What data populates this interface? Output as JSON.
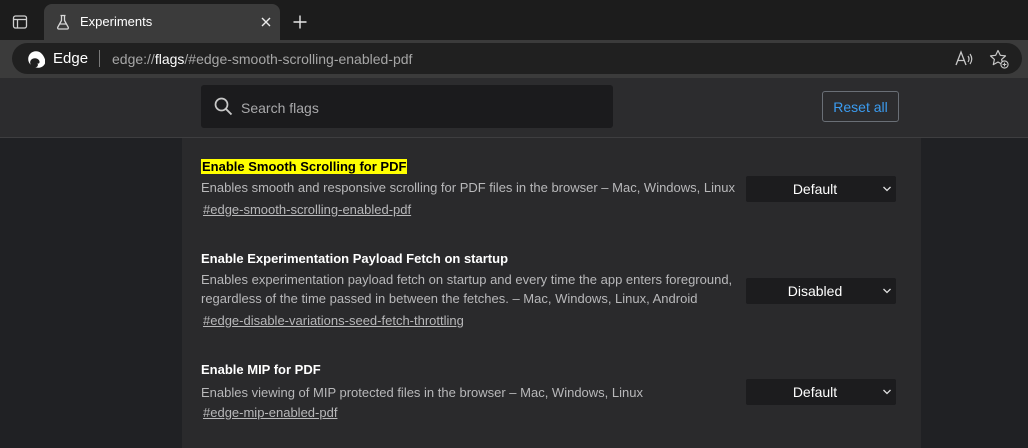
{
  "browser": {
    "tab": {
      "title": "Experiments"
    },
    "omnibox": {
      "brand": "Edge",
      "url_scheme": "edge://",
      "url_host": "flags",
      "url_rest": "/#edge-smooth-scrolling-enabled-pdf"
    },
    "icons": [
      "tab-actions-icon",
      "flask-icon",
      "close-icon",
      "plus-icon",
      "edge-logo-icon",
      "read-aloud-icon",
      "favorites-icon",
      "search-icon",
      "chevron-down-icon"
    ]
  },
  "flags_page": {
    "search": {
      "placeholder": "Search flags",
      "value": ""
    },
    "reset_label": "Reset all",
    "highlight_color": "#ffff00",
    "link_color": "#3b9cf0",
    "flags": [
      {
        "name": "Enable Smooth Scrolling for PDF",
        "description": "Enables smooth and responsive scrolling for PDF files in the browser – Mac, Windows, Linux",
        "link": "#edge-smooth-scrolling-enabled-pdf",
        "selected": "Default",
        "highlighted": true
      },
      {
        "name": "Enable Experimentation Payload Fetch on startup",
        "description": "Enables experimentation payload fetch on startup and every time the app enters foreground, regardless of the time passed in between the fetches. – Mac, Windows, Linux, Android",
        "link": "#edge-disable-variations-seed-fetch-throttling",
        "selected": "Disabled",
        "highlighted": false
      },
      {
        "name": "Enable MIP for PDF",
        "description": "Enables viewing of MIP protected files in the browser – Mac, Windows, Linux",
        "link": "#edge-mip-enabled-pdf",
        "selected": "Default",
        "highlighted": false
      }
    ]
  }
}
